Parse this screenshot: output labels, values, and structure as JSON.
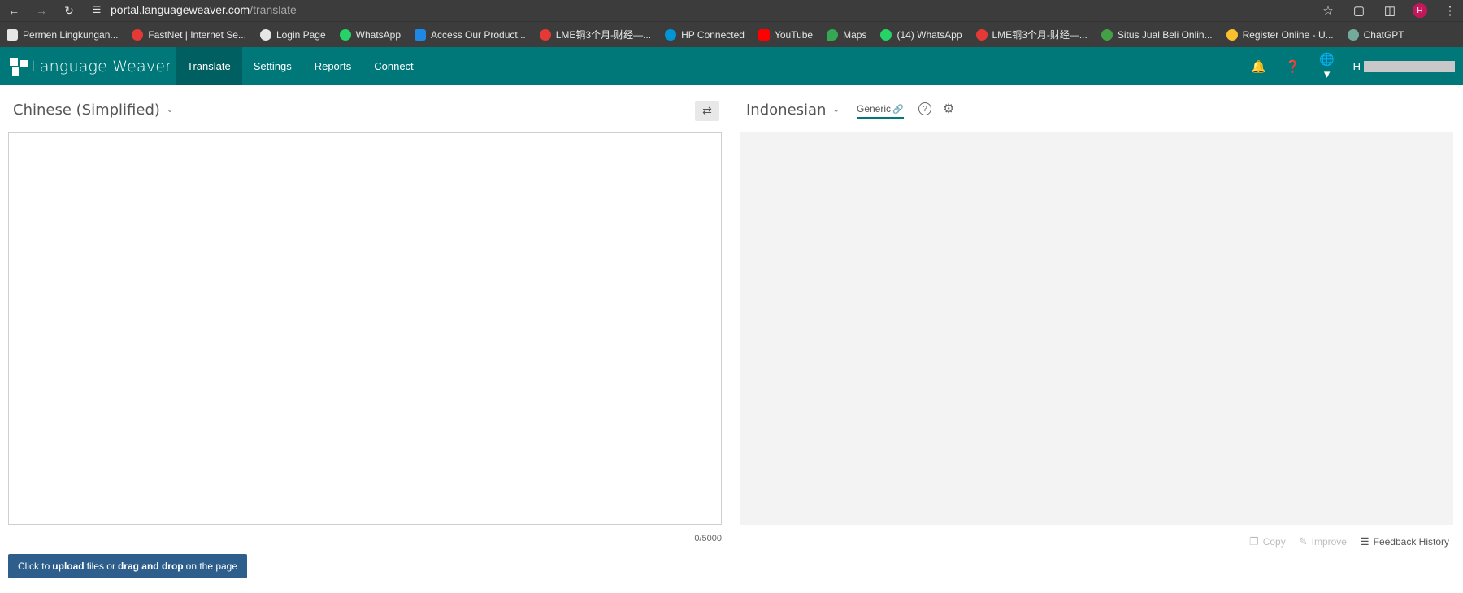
{
  "browser": {
    "url_domain": "portal.languageweaver.com",
    "url_path": "/translate",
    "profile_initial": "H",
    "icons": [
      "back-arrow-icon",
      "forward-arrow-icon",
      "reload-icon",
      "site-settings-icon",
      "star-icon",
      "extensions-icon",
      "sidepanel-icon",
      "kebab-menu-icon"
    ]
  },
  "bookmarks": [
    {
      "label": "Permen Lingkungan...",
      "color": "#e6e6e6"
    },
    {
      "label": "FastNet | Internet Se...",
      "color": "#e53935"
    },
    {
      "label": "Login Page",
      "color": "#e6e6e6"
    },
    {
      "label": "WhatsApp",
      "color": "#25d366"
    },
    {
      "label": "Access Our Product...",
      "color": "#1e88e5"
    },
    {
      "label": "LME铜3个月-财经—...",
      "color": "#e53935"
    },
    {
      "label": "HP Connected",
      "color": "#0096d6"
    },
    {
      "label": "YouTube",
      "color": "#ff0000"
    },
    {
      "label": "Maps",
      "color": "#34a853"
    },
    {
      "label": "(14) WhatsApp",
      "color": "#25d366"
    },
    {
      "label": "LME铜3个月-财经—...",
      "color": "#e53935"
    },
    {
      "label": "Situs Jual Beli Onlin...",
      "color": "#43a047"
    },
    {
      "label": "Register Online - U...",
      "color": "#fbc02d"
    },
    {
      "label": "ChatGPT",
      "color": "#74aa9c"
    }
  ],
  "app": {
    "brand": "Language Weaver",
    "nav": {
      "translate": "Translate",
      "settings": "Settings",
      "reports": "Reports",
      "connect": "Connect"
    },
    "user_initial": "H",
    "accent": "#00787a"
  },
  "translate": {
    "source_language": "Chinese (Simplified)",
    "target_language": "Indonesian",
    "model": "Generic",
    "char_count": "0/5000",
    "upload": {
      "pre": "Click to",
      "bold1": "upload",
      "mid": "files or",
      "bold2": "drag and drop",
      "post": "on the page"
    },
    "actions": {
      "copy": "Copy",
      "improve": "Improve",
      "feedback": "Feedback History"
    }
  }
}
